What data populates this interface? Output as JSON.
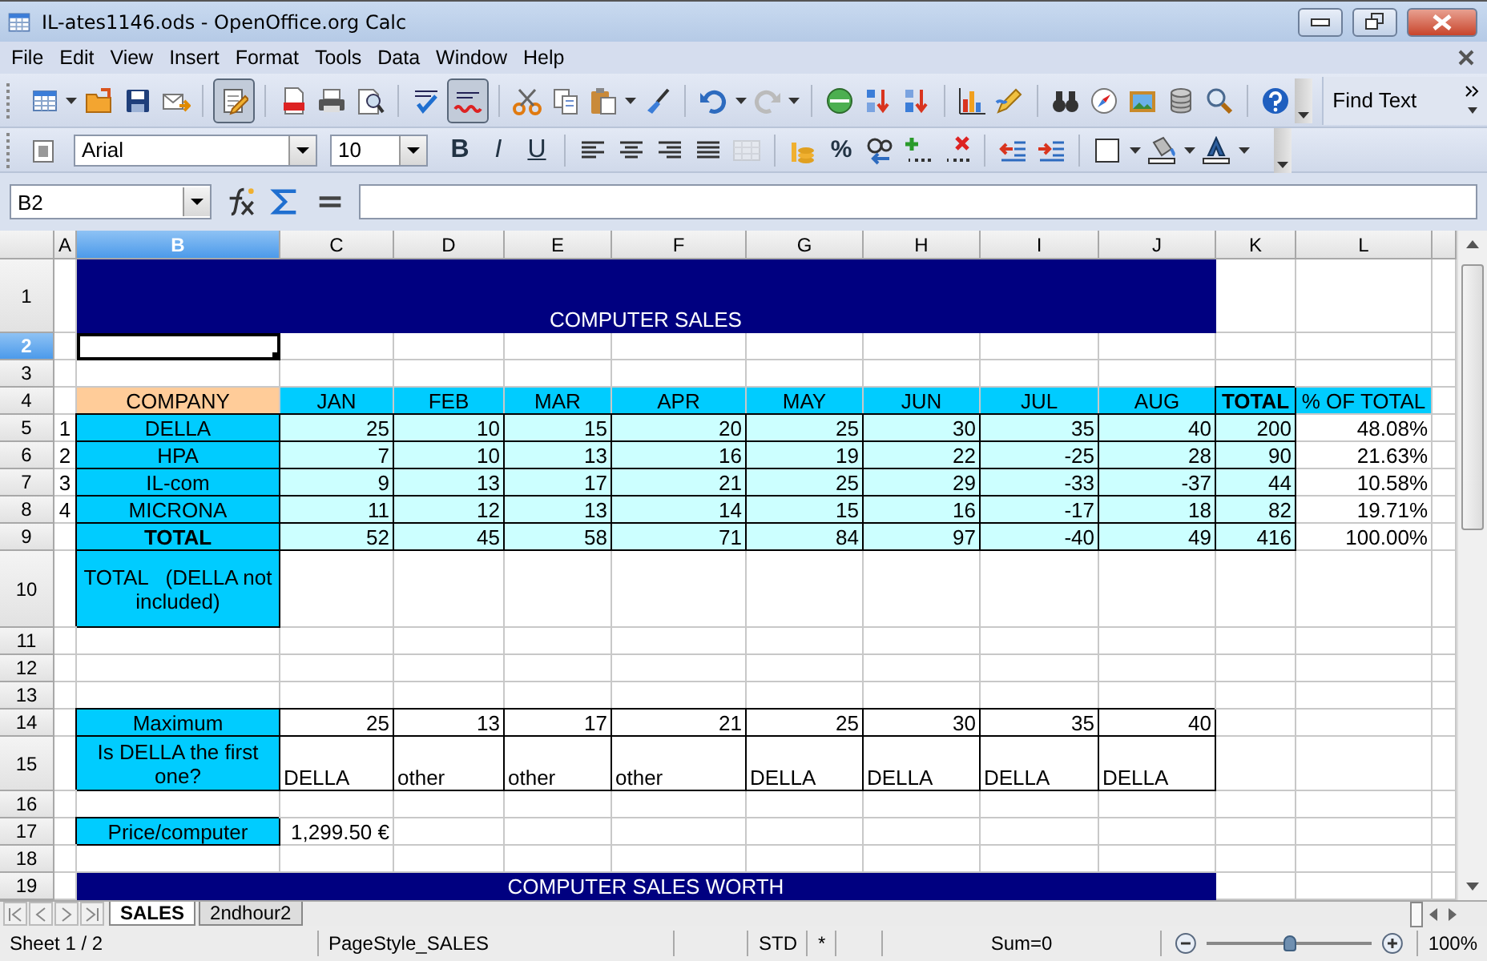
{
  "window": {
    "title": "IL-ates1146.ods - OpenOffice.org Calc"
  },
  "menu": [
    "File",
    "Edit",
    "View",
    "Insert",
    "Format",
    "Tools",
    "Data",
    "Window",
    "Help"
  ],
  "toolbar": {
    "edit_mode": true,
    "auto_spellcheck": true,
    "redo_disabled": true,
    "merge_disabled": true,
    "find": {
      "placeholder": "Find Text"
    }
  },
  "formatting": {
    "font": "Arial",
    "size": "10",
    "style_buttons": [
      "B",
      "I",
      "U"
    ],
    "percent_button": "%"
  },
  "formula_bar": {
    "cell_ref": "B2"
  },
  "sheet": {
    "columns": [
      {
        "label": "A",
        "selected": false
      },
      {
        "label": "B",
        "selected": true
      },
      {
        "label": "C",
        "selected": false
      },
      {
        "label": "D",
        "selected": false
      },
      {
        "label": "E",
        "selected": false
      },
      {
        "label": "F",
        "selected": false
      },
      {
        "label": "G",
        "selected": false
      },
      {
        "label": "H",
        "selected": false
      },
      {
        "label": "I",
        "selected": false
      },
      {
        "label": "J",
        "selected": false
      },
      {
        "label": "K",
        "selected": false
      },
      {
        "label": "L",
        "selected": false
      }
    ],
    "rows": [
      {
        "header": "1",
        "selected": false,
        "cells": [
          {
            "kind": "blank"
          },
          {
            "kind": "title",
            "text": "COMPUTER SALES"
          }
        ]
      },
      {
        "header": "2",
        "selected": true,
        "cells": []
      },
      {
        "header": "3",
        "selected": false,
        "cells": []
      },
      {
        "header": "4",
        "selected": false,
        "cells": [
          {
            "kind": "blank"
          },
          {
            "kind": "company-header",
            "text": "COMPANY"
          },
          {
            "kind": "header",
            "text": "JAN"
          },
          {
            "kind": "header",
            "text": "FEB"
          },
          {
            "kind": "header",
            "text": "MAR"
          },
          {
            "kind": "header",
            "text": "APR"
          },
          {
            "kind": "header",
            "text": "MAY"
          },
          {
            "kind": "header",
            "text": "JUN"
          },
          {
            "kind": "header",
            "text": "JUL"
          },
          {
            "kind": "header",
            "text": "AUG"
          },
          {
            "kind": "total-header",
            "text": "TOTAL"
          },
          {
            "kind": "header",
            "text": "% OF TOTAL"
          }
        ]
      },
      {
        "header": "5",
        "selected": false,
        "cells": [
          {
            "kind": "index",
            "text": "1"
          },
          {
            "kind": "label",
            "text": "DELLA"
          },
          {
            "kind": "number",
            "text": "25"
          },
          {
            "kind": "number",
            "text": "10"
          },
          {
            "kind": "number",
            "text": "15"
          },
          {
            "kind": "number",
            "text": "20"
          },
          {
            "kind": "number",
            "text": "25"
          },
          {
            "kind": "number",
            "text": "30"
          },
          {
            "kind": "number",
            "text": "35"
          },
          {
            "kind": "number",
            "text": "40"
          },
          {
            "kind": "number",
            "text": "200"
          },
          {
            "kind": "plain-number",
            "text": "48.08%"
          }
        ]
      },
      {
        "header": "6",
        "selected": false,
        "cells": [
          {
            "kind": "index",
            "text": "2"
          },
          {
            "kind": "label",
            "text": "HPA"
          },
          {
            "kind": "number",
            "text": "7"
          },
          {
            "kind": "number",
            "text": "10"
          },
          {
            "kind": "number",
            "text": "13"
          },
          {
            "kind": "number",
            "text": "16"
          },
          {
            "kind": "number",
            "text": "19"
          },
          {
            "kind": "number",
            "text": "22"
          },
          {
            "kind": "number",
            "text": "-25"
          },
          {
            "kind": "number",
            "text": "28"
          },
          {
            "kind": "number",
            "text": "90"
          },
          {
            "kind": "plain-number",
            "text": "21.63%"
          }
        ]
      },
      {
        "header": "7",
        "selected": false,
        "cells": [
          {
            "kind": "index",
            "text": "3"
          },
          {
            "kind": "label",
            "text": "IL-com"
          },
          {
            "kind": "number",
            "text": "9"
          },
          {
            "kind": "number",
            "text": "13"
          },
          {
            "kind": "number",
            "text": "17"
          },
          {
            "kind": "number",
            "text": "21"
          },
          {
            "kind": "number",
            "text": "25"
          },
          {
            "kind": "number",
            "text": "29"
          },
          {
            "kind": "number",
            "text": "-33"
          },
          {
            "kind": "number",
            "text": "-37"
          },
          {
            "kind": "number",
            "text": "44"
          },
          {
            "kind": "plain-number",
            "text": "10.58%"
          }
        ]
      },
      {
        "header": "8",
        "selected": false,
        "cells": [
          {
            "kind": "index",
            "text": "4"
          },
          {
            "kind": "label",
            "text": "MICRONA"
          },
          {
            "kind": "number",
            "text": "11"
          },
          {
            "kind": "number",
            "text": "12"
          },
          {
            "kind": "number",
            "text": "13"
          },
          {
            "kind": "number",
            "text": "14"
          },
          {
            "kind": "number",
            "text": "15"
          },
          {
            "kind": "number",
            "text": "16"
          },
          {
            "kind": "number",
            "text": "-17"
          },
          {
            "kind": "number",
            "text": "18"
          },
          {
            "kind": "number",
            "text": "82"
          },
          {
            "kind": "plain-number",
            "text": "19.71%"
          }
        ]
      },
      {
        "header": "9",
        "selected": false,
        "cells": [
          {
            "kind": "blank"
          },
          {
            "kind": "total-label",
            "text": "TOTAL"
          },
          {
            "kind": "number",
            "text": "52"
          },
          {
            "kind": "number",
            "text": "45"
          },
          {
            "kind": "number",
            "text": "58"
          },
          {
            "kind": "number",
            "text": "71"
          },
          {
            "kind": "number",
            "text": "84"
          },
          {
            "kind": "number",
            "text": "97"
          },
          {
            "kind": "number",
            "text": "-40"
          },
          {
            "kind": "number",
            "text": "49"
          },
          {
            "kind": "number",
            "text": "416"
          },
          {
            "kind": "plain-number",
            "text": "100.00%"
          }
        ]
      },
      {
        "header": "10",
        "selected": false,
        "cells": [
          {
            "kind": "blank"
          },
          {
            "kind": "label",
            "text": "TOTAL   (DELLA not included)"
          }
        ]
      },
      {
        "header": "11",
        "selected": false,
        "cells": []
      },
      {
        "header": "12",
        "selected": false,
        "cells": []
      },
      {
        "header": "13",
        "selected": false,
        "cells": []
      },
      {
        "header": "14",
        "selected": false,
        "cells": [
          {
            "kind": "blank"
          },
          {
            "kind": "label",
            "text": "Maximum"
          },
          {
            "kind": "result",
            "text": "25"
          },
          {
            "kind": "result",
            "text": "13"
          },
          {
            "kind": "result",
            "text": "17"
          },
          {
            "kind": "result",
            "text": "21"
          },
          {
            "kind": "result",
            "text": "25"
          },
          {
            "kind": "result",
            "text": "30"
          },
          {
            "kind": "result",
            "text": "35"
          },
          {
            "kind": "result",
            "text": "40"
          }
        ]
      },
      {
        "header": "15",
        "selected": false,
        "cells": [
          {
            "kind": "blank"
          },
          {
            "kind": "label",
            "text": "Is DELLA the first one?"
          },
          {
            "kind": "answer",
            "text": "DELLA"
          },
          {
            "kind": "answer",
            "text": "other"
          },
          {
            "kind": "answer",
            "text": "other"
          },
          {
            "kind": "answer",
            "text": "other"
          },
          {
            "kind": "answer",
            "text": "DELLA"
          },
          {
            "kind": "answer",
            "text": "DELLA"
          },
          {
            "kind": "answer",
            "text": "DELLA"
          },
          {
            "kind": "answer",
            "text": "DELLA"
          }
        ]
      },
      {
        "header": "16",
        "selected": false,
        "cells": []
      },
      {
        "header": "17",
        "selected": false,
        "cells": [
          {
            "kind": "blank"
          },
          {
            "kind": "label",
            "text": "Price/computer"
          },
          {
            "kind": "plain-number",
            "text": "1,299.50 €"
          }
        ]
      },
      {
        "header": "18",
        "selected": false,
        "cells": []
      },
      {
        "header": "19",
        "selected": false,
        "cells": [
          {
            "kind": "blank"
          },
          {
            "kind": "title",
            "text": "COMPUTER SALES WORTH"
          }
        ]
      }
    ]
  },
  "sheet_tabs": [
    {
      "label": "SALES",
      "selected": true
    },
    {
      "label": "2ndhour2",
      "selected": false
    }
  ],
  "status_bar": {
    "sheet": "Sheet 1 / 2",
    "page_style": "PageStyle_SALES",
    "mode": "STD",
    "modified": "*",
    "sum": "Sum=0",
    "zoom": {
      "level": 0.5,
      "reading": "100%"
    }
  }
}
